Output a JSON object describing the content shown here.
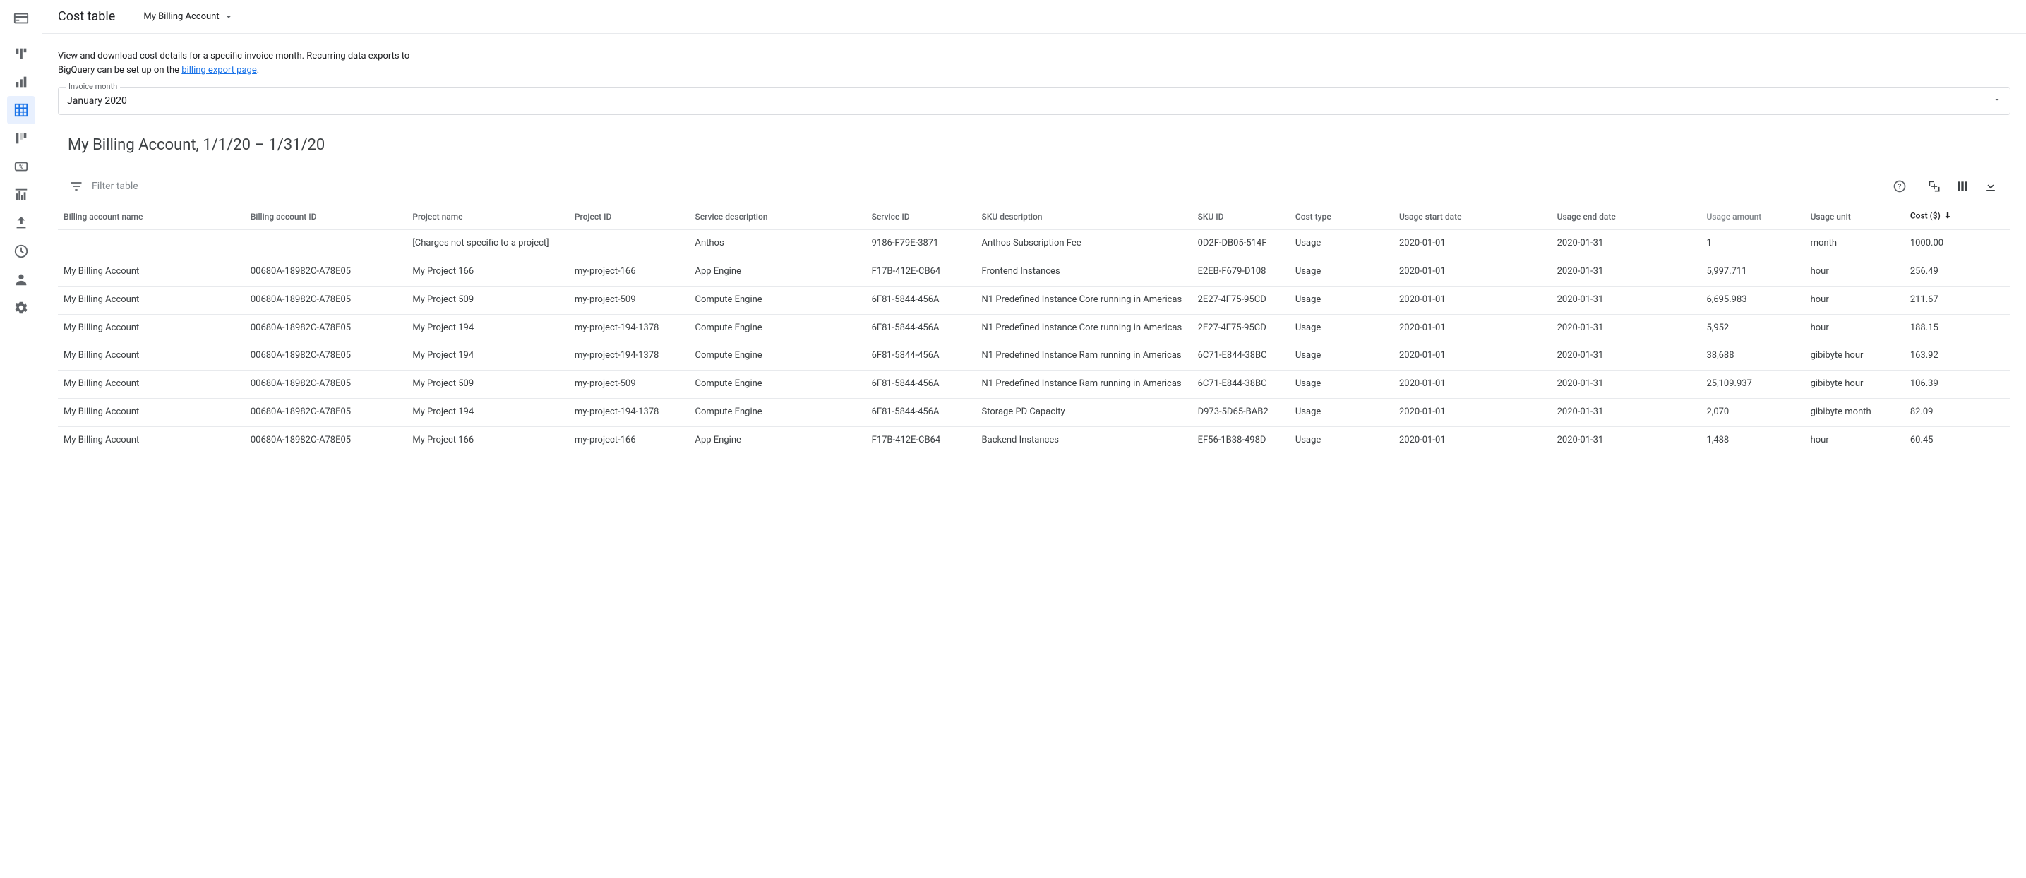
{
  "header": {
    "page_title": "Cost table",
    "account_name": "My Billing Account"
  },
  "intro": {
    "line1": "View and download cost details for a specific invoice month. Recurring data exports to",
    "line2a": "BigQuery can be set up on the ",
    "link_text": "billing export page",
    "line2b": "."
  },
  "invoice_month": {
    "label": "Invoice month",
    "value": "January 2020"
  },
  "subheading": "My Billing Account, 1/1/20 – 1/31/20",
  "filter": {
    "placeholder": "Filter table"
  },
  "columns": [
    "Billing account name",
    "Billing account ID",
    "Project name",
    "Project ID",
    "Service description",
    "Service ID",
    "SKU description",
    "SKU ID",
    "Cost type",
    "Usage start date",
    "Usage end date",
    "Usage amount",
    "Usage unit",
    "Cost ($)"
  ],
  "rows": [
    {
      "billing_account_name": "",
      "billing_account_id": "",
      "project_name": "[Charges not specific to a project]",
      "project_id": "",
      "service_description": "Anthos",
      "service_id": "9186-F79E-3871",
      "sku_description": "Anthos Subscription Fee",
      "sku_id": "0D2F-DB05-514F",
      "cost_type": "Usage",
      "usage_start": "2020-01-01",
      "usage_end": "2020-01-31",
      "usage_amount": "1",
      "usage_unit": "month",
      "cost": "1000.00"
    },
    {
      "billing_account_name": "My Billing Account",
      "billing_account_id": "00680A-18982C-A78E05",
      "project_name": "My Project 166",
      "project_id": "my-project-166",
      "service_description": "App Engine",
      "service_id": "F17B-412E-CB64",
      "sku_description": "Frontend Instances",
      "sku_id": "E2EB-F679-D108",
      "cost_type": "Usage",
      "usage_start": "2020-01-01",
      "usage_end": "2020-01-31",
      "usage_amount": "5,997.711",
      "usage_unit": "hour",
      "cost": "256.49"
    },
    {
      "billing_account_name": "My Billing Account",
      "billing_account_id": "00680A-18982C-A78E05",
      "project_name": "My Project 509",
      "project_id": "my-project-509",
      "service_description": "Compute Engine",
      "service_id": "6F81-5844-456A",
      "sku_description": "N1 Predefined Instance Core running in Americas",
      "sku_id": "2E27-4F75-95CD",
      "cost_type": "Usage",
      "usage_start": "2020-01-01",
      "usage_end": "2020-01-31",
      "usage_amount": "6,695.983",
      "usage_unit": "hour",
      "cost": "211.67"
    },
    {
      "billing_account_name": "My Billing Account",
      "billing_account_id": "00680A-18982C-A78E05",
      "project_name": "My Project 194",
      "project_id": "my-project-194-1378",
      "service_description": "Compute Engine",
      "service_id": "6F81-5844-456A",
      "sku_description": "N1 Predefined Instance Core running in Americas",
      "sku_id": "2E27-4F75-95CD",
      "cost_type": "Usage",
      "usage_start": "2020-01-01",
      "usage_end": "2020-01-31",
      "usage_amount": "5,952",
      "usage_unit": "hour",
      "cost": "188.15"
    },
    {
      "billing_account_name": "My Billing Account",
      "billing_account_id": "00680A-18982C-A78E05",
      "project_name": "My Project 194",
      "project_id": "my-project-194-1378",
      "service_description": "Compute Engine",
      "service_id": "6F81-5844-456A",
      "sku_description": "N1 Predefined Instance Ram running in Americas",
      "sku_id": "6C71-E844-38BC",
      "cost_type": "Usage",
      "usage_start": "2020-01-01",
      "usage_end": "2020-01-31",
      "usage_amount": "38,688",
      "usage_unit": "gibibyte hour",
      "cost": "163.92"
    },
    {
      "billing_account_name": "My Billing Account",
      "billing_account_id": "00680A-18982C-A78E05",
      "project_name": "My Project 509",
      "project_id": "my-project-509",
      "service_description": "Compute Engine",
      "service_id": "6F81-5844-456A",
      "sku_description": "N1 Predefined Instance Ram running in Americas",
      "sku_id": "6C71-E844-38BC",
      "cost_type": "Usage",
      "usage_start": "2020-01-01",
      "usage_end": "2020-01-31",
      "usage_amount": "25,109.937",
      "usage_unit": "gibibyte hour",
      "cost": "106.39"
    },
    {
      "billing_account_name": "My Billing Account",
      "billing_account_id": "00680A-18982C-A78E05",
      "project_name": "My Project 194",
      "project_id": "my-project-194-1378",
      "service_description": "Compute Engine",
      "service_id": "6F81-5844-456A",
      "sku_description": "Storage PD Capacity",
      "sku_id": "D973-5D65-BAB2",
      "cost_type": "Usage",
      "usage_start": "2020-01-01",
      "usage_end": "2020-01-31",
      "usage_amount": "2,070",
      "usage_unit": "gibibyte month",
      "cost": "82.09"
    },
    {
      "billing_account_name": "My Billing Account",
      "billing_account_id": "00680A-18982C-A78E05",
      "project_name": "My Project 166",
      "project_id": "my-project-166",
      "service_description": "App Engine",
      "service_id": "F17B-412E-CB64",
      "sku_description": "Backend Instances",
      "sku_id": "EF56-1B38-498D",
      "cost_type": "Usage",
      "usage_start": "2020-01-01",
      "usage_end": "2020-01-31",
      "usage_amount": "1,488",
      "usage_unit": "hour",
      "cost": "60.45"
    }
  ],
  "col_widths_pct": [
    9.0,
    7.8,
    7.8,
    5.8,
    8.5,
    5.3,
    10.4,
    4.7,
    5.0,
    7.6,
    7.2,
    5.0,
    4.8,
    5.1
  ]
}
